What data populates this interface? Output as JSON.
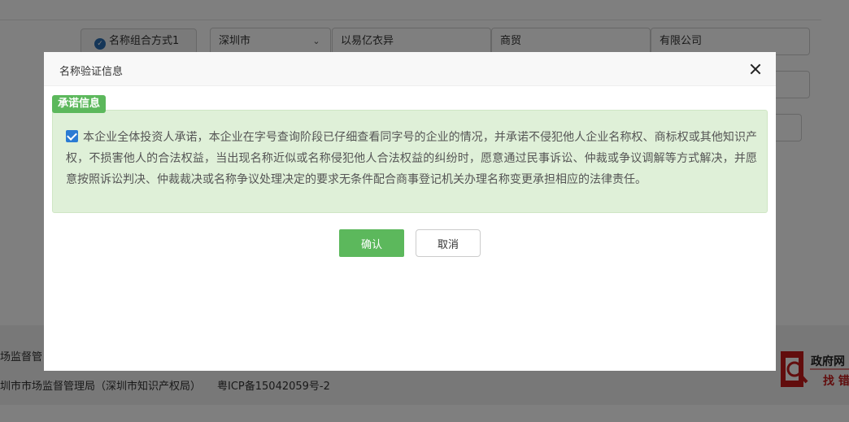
{
  "background": {
    "name_combo_label": "名称组合方式1",
    "city_value": "深圳市",
    "caret_icon": "chevron-down-icon",
    "word_value": "以易亿衣异",
    "industry_value": "商贸",
    "org_form_value": "有限公司",
    "footer_line1": "场监督管",
    "footer_org": "圳市市场监督管理局（深圳市知识产权局）",
    "footer_icp": "粤ICP备15042059号-2",
    "gov_badge_text1": "政府网",
    "gov_badge_text2": "找 错"
  },
  "modal": {
    "title": "名称验证信息",
    "close_icon": "close-icon",
    "pledge_tag": "承诺信息",
    "pledge_text": "本企业全体投资人承诺，本企业在字号查询阶段已仔细查看同字号的企业的情况，并承诺不侵犯他人企业名称权、商标权或其他知识产权，不损害他人的合法权益，当出现名称近似或名称侵犯他人合法权益的纠纷时，愿意通过民事诉讼、仲裁或争议调解等方式解决，并愿意按照诉讼判决、仲裁裁决或名称争议处理决定的要求无条件配合商事登记机关办理名称变更承担相应的法律责任。",
    "pledge_checked": true,
    "confirm_label": "确认",
    "cancel_label": "取消"
  },
  "colors": {
    "success_green": "#5cb85c",
    "pledge_bg": "#dff0d8",
    "checkbox_blue": "#2b7bd3",
    "overlay": "rgba(0,0,0,0.5)"
  }
}
